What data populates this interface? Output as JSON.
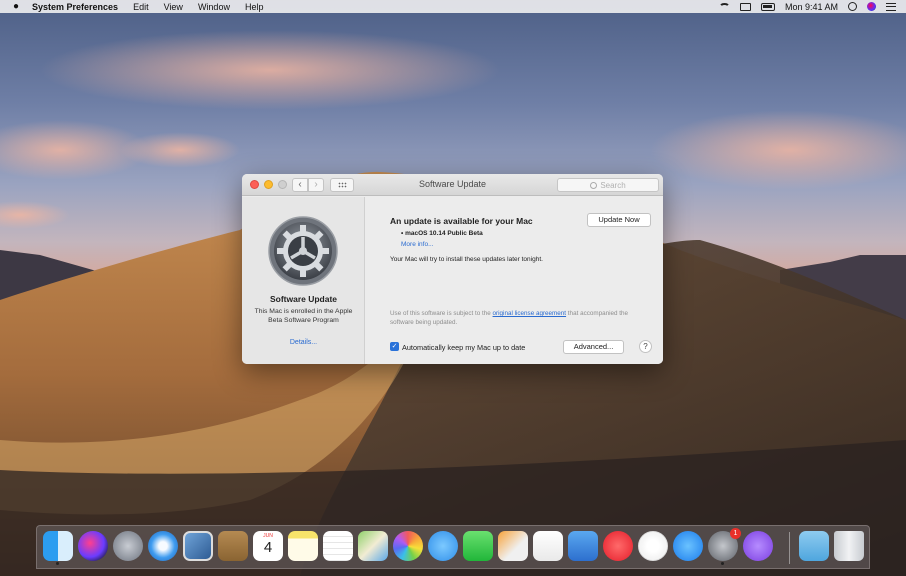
{
  "menubar": {
    "apple_icon": "apple-logo",
    "app_name": "System Preferences",
    "menus": [
      "Edit",
      "View",
      "Window",
      "Help"
    ],
    "clock": "Mon 9:41 AM",
    "status_icons": [
      "wifi-icon",
      "airplay-icon",
      "battery-icon",
      "spotlight-icon",
      "siri-icon",
      "notification-center-icon"
    ]
  },
  "window": {
    "title": "Software Update",
    "search_placeholder": "Search",
    "left_panel": {
      "title": "Software Update",
      "description": "This Mac is enrolled in the Apple Beta Software Program",
      "details_link": "Details..."
    },
    "main": {
      "headline": "An update is available for your Mac",
      "update_now_label": "Update Now",
      "update_item": "• macOS 10.14 Public Beta",
      "more_info": "More info...",
      "note": "Your Mac will try to install these updates later tonight.",
      "legal_prefix": "Use of this software is subject to the ",
      "legal_link": "original license agreement",
      "legal_suffix": " that accompanied the software being updated.",
      "auto_update_label": "Automatically keep my Mac up to date",
      "auto_update_checked": true,
      "advanced_label": "Advanced...",
      "help_label": "?"
    }
  },
  "dock": {
    "calendar_month": "JUN",
    "calendar_day": "4",
    "system_prefs_badge": "1",
    "apps": [
      "finder",
      "siri",
      "launchpad",
      "safari",
      "photo-browser",
      "notes-book",
      "calendar",
      "notes",
      "reminders",
      "maps",
      "photos",
      "messages",
      "facetime",
      "pages",
      "numbers",
      "keynote",
      "news",
      "itunes",
      "app-store",
      "system-preferences",
      "feedback-assistant",
      "downloads",
      "trash"
    ]
  },
  "colors": {
    "accent": "#2a72d9",
    "link": "#2a6bd0",
    "close": "#fc5f57",
    "minimize": "#fdbc2e"
  }
}
